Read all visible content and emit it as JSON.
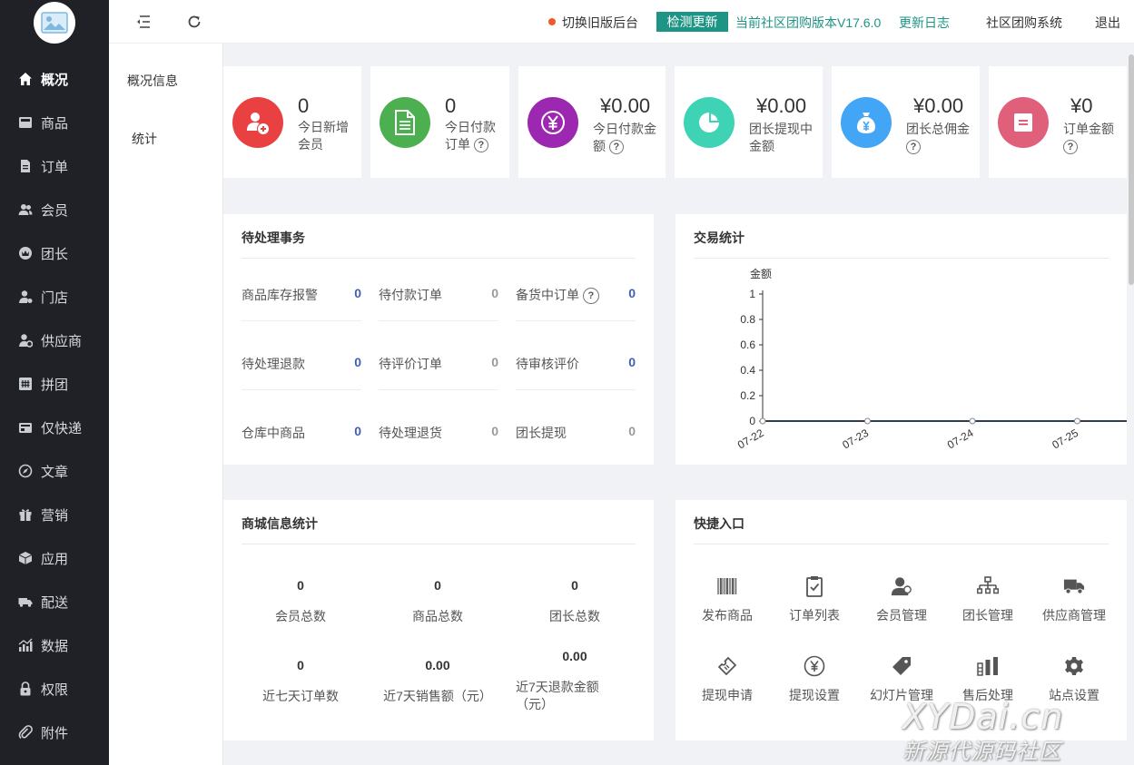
{
  "sidebar": {
    "items": [
      {
        "label": "概况",
        "icon": "home-icon"
      },
      {
        "label": "商品",
        "icon": "goods-icon"
      },
      {
        "label": "订单",
        "icon": "order-icon"
      },
      {
        "label": "会员",
        "icon": "members-icon"
      },
      {
        "label": "团长",
        "icon": "leader-icon"
      },
      {
        "label": "门店",
        "icon": "store-icon"
      },
      {
        "label": "供应商",
        "icon": "supplier-icon"
      },
      {
        "label": "拼团",
        "icon": "group-buy-icon"
      },
      {
        "label": "仅快递",
        "icon": "express-icon"
      },
      {
        "label": "文章",
        "icon": "compass-icon"
      },
      {
        "label": "营销",
        "icon": "gift-icon"
      },
      {
        "label": "应用",
        "icon": "cube-icon"
      },
      {
        "label": "配送",
        "icon": "truck-icon"
      },
      {
        "label": "数据",
        "icon": "bar-chart-icon"
      },
      {
        "label": "权限",
        "icon": "lock-icon"
      },
      {
        "label": "附件",
        "icon": "paperclip-icon"
      }
    ]
  },
  "subnav": {
    "items": [
      "概况信息",
      "统计"
    ]
  },
  "header": {
    "switch_old": "切换旧版后台",
    "check_update": "检测更新",
    "version": "当前社区团购版本V17.6.0",
    "changelog": "更新日志",
    "system_name": "社区团购系统",
    "logout": "退出"
  },
  "stats": [
    {
      "value": "0",
      "label1": "今日新增",
      "label2": "会员",
      "help": false,
      "color": "#e94141"
    },
    {
      "value": "0",
      "label1": "今日付款",
      "label2": "订单",
      "help": true,
      "color": "#4caf50"
    },
    {
      "value": "¥0.00",
      "label1": "今日付款金",
      "label2": "额",
      "help": true,
      "color": "#9c27b0"
    },
    {
      "value": "¥0.00",
      "label1": "团长提现中",
      "label2": "金额",
      "help": false,
      "color": "#3ed3b4"
    },
    {
      "value": "¥0.00",
      "label1": "团长总佣金",
      "label2": "",
      "help": true,
      "color": "#42a5f5"
    },
    {
      "value": "¥0",
      "label1": "订单金额",
      "label2": "",
      "help": true,
      "color": "#e0607c"
    }
  ],
  "pending": {
    "title": "待处理事务",
    "help_mark": "?",
    "items": [
      {
        "label": "商品库存报警",
        "value": "0",
        "highlight": true
      },
      {
        "label": "待付款订单",
        "value": "0",
        "highlight": false
      },
      {
        "label": "备货中订单",
        "value": "0",
        "highlight": true,
        "help": true
      },
      {
        "label": "待处理退款",
        "value": "0",
        "highlight": true
      },
      {
        "label": "待评价订单",
        "value": "0",
        "highlight": false
      },
      {
        "label": "待审核评价",
        "value": "0",
        "highlight": true
      },
      {
        "label": "仓库中商品",
        "value": "0",
        "highlight": true
      },
      {
        "label": "待处理退货",
        "value": "0",
        "highlight": false
      },
      {
        "label": "团长提现",
        "value": "0",
        "highlight": false
      }
    ]
  },
  "trade": {
    "title": "交易统计",
    "chart_data": {
      "type": "line",
      "ylabel": "金额",
      "ylim": [
        0,
        1
      ],
      "yticks": [
        "1",
        "0.8",
        "0.6",
        "0.4",
        "0.2",
        "0"
      ],
      "x": [
        "07-22",
        "07-23",
        "07-24",
        "07-25"
      ],
      "series": [
        {
          "values": [
            0,
            0,
            0,
            0
          ]
        }
      ],
      "grid": false
    }
  },
  "mall": {
    "title": "商城信息统计",
    "items": [
      {
        "value": "0",
        "label": "会员总数"
      },
      {
        "value": "0",
        "label": "商品总数"
      },
      {
        "value": "0",
        "label": "团长总数"
      },
      {
        "value": "0",
        "label": "近七天订单数"
      },
      {
        "value": "0.00",
        "label": "近7天销售额（元）"
      },
      {
        "value": "0.00",
        "label": "近7天退款金额（元）"
      }
    ]
  },
  "quick": {
    "title": "快捷入口",
    "items": [
      {
        "label": "发布商品",
        "icon": "barcode-icon"
      },
      {
        "label": "订单列表",
        "icon": "clipboard-check-icon"
      },
      {
        "label": "会员管理",
        "icon": "member-manage-icon"
      },
      {
        "label": "团长管理",
        "icon": "org-chart-icon"
      },
      {
        "label": "供应商管理",
        "icon": "delivery-truck-icon"
      },
      {
        "label": "提现申请",
        "icon": "ticket-icon"
      },
      {
        "label": "提现设置",
        "icon": "yen-circle-icon"
      },
      {
        "label": "幻灯片管理",
        "icon": "tag-icon"
      },
      {
        "label": "售后处理",
        "icon": "bars-icon"
      },
      {
        "label": "站点设置",
        "icon": "gear-icon"
      }
    ]
  },
  "watermark": {
    "line1": "XYDai.cn",
    "line2": "新源代源码社区"
  },
  "colors": {
    "sidebar_bg": "#1f2127",
    "accent": "#1e9485",
    "highlight_value": "#3f5fb5",
    "muted_value": "#999999"
  }
}
